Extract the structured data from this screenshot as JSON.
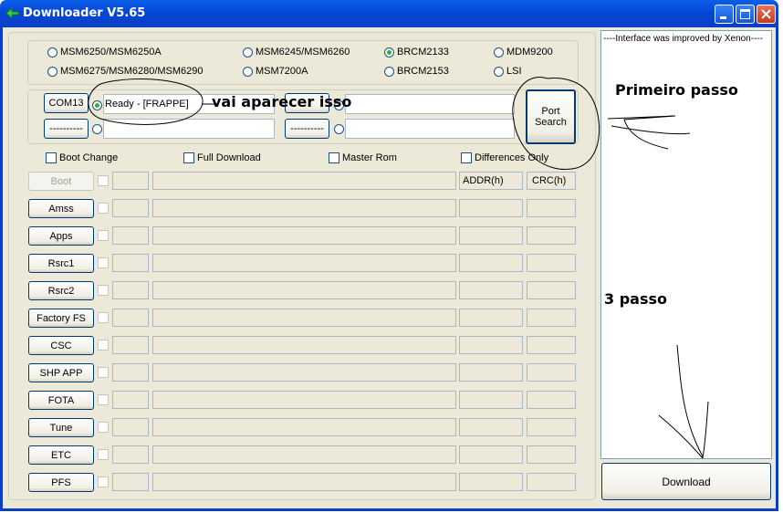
{
  "window": {
    "title": "Downloader V5.65"
  },
  "chipsets": [
    {
      "label": "MSM6250/MSM6250A",
      "selected": false
    },
    {
      "label": "MSM6245/MSM6260",
      "selected": false
    },
    {
      "label": "BRCM2133",
      "selected": true
    },
    {
      "label": "MDM9200",
      "selected": false
    },
    {
      "label": "MSM6275/MSM6280/MSM6290",
      "selected": false
    },
    {
      "label": "MSM7200A",
      "selected": false
    },
    {
      "label": "BRCM2153",
      "selected": false
    },
    {
      "label": "LSI",
      "selected": false
    }
  ],
  "ports": {
    "port1_label": "COM13",
    "port1_status": "Ready - [FRAPPE]",
    "port2_label": "----------",
    "port3_label": "----------",
    "port_search_line1": "Port",
    "port_search_line2": "Search"
  },
  "options": [
    {
      "label": "Boot Change",
      "checked": false
    },
    {
      "label": "Full Download",
      "checked": false
    },
    {
      "label": "Master Rom",
      "checked": false
    },
    {
      "label": "Differences Only",
      "checked": false
    }
  ],
  "table": {
    "addr_header": "ADDR(h)",
    "crc_header": "CRC(h)"
  },
  "files": [
    {
      "label": "Boot",
      "enabled": false
    },
    {
      "label": "Amss",
      "enabled": true
    },
    {
      "label": "Apps",
      "enabled": true
    },
    {
      "label": "Rsrc1",
      "enabled": true
    },
    {
      "label": "Rsrc2",
      "enabled": true
    },
    {
      "label": "Factory FS",
      "enabled": true
    },
    {
      "label": "CSC",
      "enabled": true
    },
    {
      "label": "SHP APP",
      "enabled": true
    },
    {
      "label": "FOTA",
      "enabled": true
    },
    {
      "label": "Tune",
      "enabled": true
    },
    {
      "label": "ETC",
      "enabled": true
    },
    {
      "label": "PFS",
      "enabled": true
    }
  ],
  "log": {
    "text": "----Interface was improved by Xenon----"
  },
  "download_button": "Download",
  "annotations": {
    "note1": "vai aparecer isso",
    "note2": "Primeiro passo",
    "note3": "3 passo"
  },
  "colors": {
    "titlebar": "#0546d6",
    "window_bg": "#ece9d8",
    "radio_selected": "#2db33a"
  }
}
